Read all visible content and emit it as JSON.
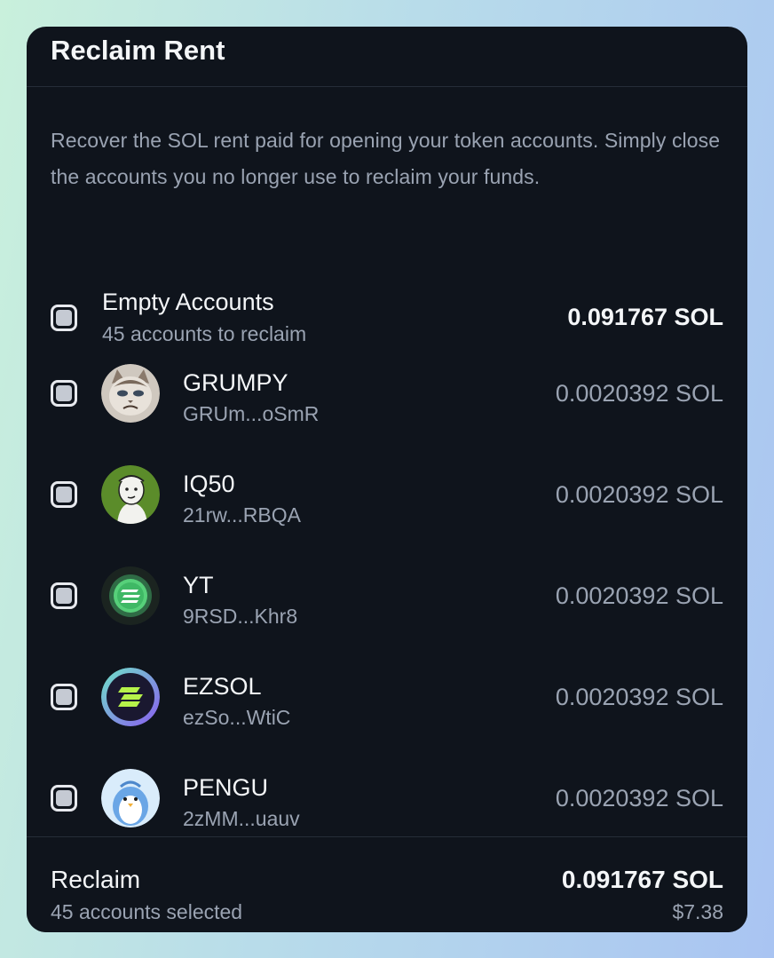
{
  "panel": {
    "title": "Reclaim Rent",
    "description": "Recover the SOL rent paid for opening your token accounts. Simply close the accounts you no longer use to reclaim your funds."
  },
  "empty_accounts": {
    "label": "Empty Accounts",
    "sub": "45 accounts to reclaim",
    "amount": "0.091767 SOL",
    "checked": true
  },
  "tokens": [
    {
      "name": "GRUMPY",
      "address": "GRUm...oSmR",
      "amount": "0.0020392 SOL",
      "icon": "grumpy-cat-icon",
      "checked": true
    },
    {
      "name": "IQ50",
      "address": "21rw...RBQA",
      "amount": "0.0020392 SOL",
      "icon": "iq50-icon",
      "checked": true
    },
    {
      "name": "YT",
      "address": "9RSD...Khr8",
      "amount": "0.0020392 SOL",
      "icon": "yt-token-icon",
      "checked": true
    },
    {
      "name": "EZSOL",
      "address": "ezSo...WtiC",
      "amount": "0.0020392 SOL",
      "icon": "ezsol-icon",
      "checked": true
    },
    {
      "name": "PENGU",
      "address": "2zMM...uauv",
      "amount": "0.0020392 SOL",
      "icon": "pengu-icon",
      "checked": true
    }
  ],
  "footer": {
    "label": "Reclaim",
    "sub": "45 accounts selected",
    "amount": "0.091767 SOL",
    "usd": "$7.38"
  }
}
